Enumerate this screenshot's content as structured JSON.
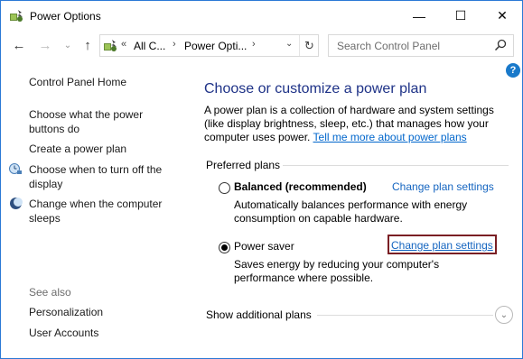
{
  "window": {
    "title": "Power Options",
    "min_glyph": "—",
    "max_glyph": "☐",
    "close_glyph": "✕"
  },
  "nav": {
    "back_glyph": "←",
    "forward_glyph": "→",
    "history_glyph": "⌄",
    "up_glyph": "↑",
    "address_overflow": "«",
    "address_crumbs": [
      "All C...",
      "Power Opti..."
    ],
    "crumb_sep": "›",
    "dropdown_glyph": "⌄",
    "refresh_glyph": "↻",
    "search_placeholder": "Search Control Panel",
    "search_icon": "search-icon"
  },
  "help_label": "?",
  "left_pane": {
    "home": "Control Panel Home",
    "links": [
      "Choose what the power buttons do",
      "Create a power plan",
      "Choose when to turn off the display",
      "Change when the computer sleeps"
    ],
    "see_also_label": "See also",
    "see_also_links": [
      "Personalization",
      "User Accounts"
    ]
  },
  "main": {
    "heading": "Choose or customize a power plan",
    "description": "A power plan is a collection of hardware and system settings (like display brightness, sleep, etc.) that manages how your computer uses power.",
    "tell_more_link": "Tell me more about power plans",
    "group_label": "Preferred plans",
    "plans": [
      {
        "name": "Balanced (recommended)",
        "selected": false,
        "description": "Automatically balances performance with energy consumption on capable hardware.",
        "link": "Change plan settings"
      },
      {
        "name": "Power saver",
        "selected": true,
        "description": "Saves energy by reducing your computer's performance where possible.",
        "link": "Change plan settings"
      }
    ],
    "show_additional": "Show additional plans",
    "expand_glyph": "⌄"
  },
  "colors": {
    "heading": "#1e3287",
    "link": "#0066cc",
    "focus_border": "#7a1f24",
    "help_badge": "#1979ca"
  }
}
